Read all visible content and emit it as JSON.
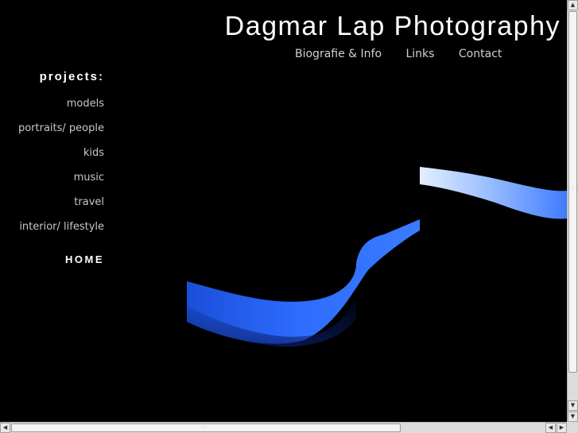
{
  "site": {
    "title": "Dagmar Lap Photography"
  },
  "topnav": {
    "items": [
      {
        "label": "Biografie & Info"
      },
      {
        "label": "Links"
      },
      {
        "label": "Contact"
      }
    ]
  },
  "sidebar": {
    "heading": "projects:",
    "items": [
      {
        "label": "models"
      },
      {
        "label": "portraits/ people"
      },
      {
        "label": "kids"
      },
      {
        "label": "music"
      },
      {
        "label": "travel"
      },
      {
        "label": "interior/ lifestyle"
      }
    ],
    "home": "HOME"
  },
  "photo": {
    "subject": "blue light ribbon on black background"
  },
  "colors": {
    "background": "#000000",
    "ribbon": "#2b6cff",
    "ribbon_highlight": "#cfe0ff"
  },
  "scrollbars": {
    "vertical_position": 0.0,
    "horizontal_position": 0.0
  }
}
